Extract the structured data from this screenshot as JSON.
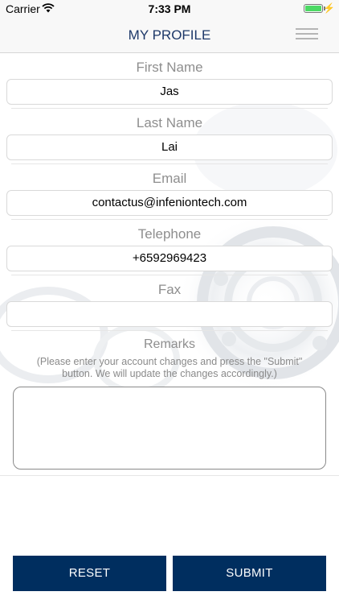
{
  "status_bar": {
    "carrier": "Carrier",
    "time": "7:33 PM",
    "battery_level": 1.0
  },
  "nav": {
    "title": "MY PROFILE",
    "menu_icon": "hamburger-menu-icon"
  },
  "form": {
    "first_name": {
      "label": "First Name",
      "value": "Jas"
    },
    "last_name": {
      "label": "Last Name",
      "value": "Lai"
    },
    "email": {
      "label": "Email",
      "value": "contactus@infeniontech.com"
    },
    "telephone": {
      "label": "Telephone",
      "value": "+6592969423"
    },
    "fax": {
      "label": "Fax",
      "value": ""
    },
    "remarks": {
      "label": "Remarks",
      "hint": "(Please enter your account changes and press the \"Submit\" button. We will update the changes accordingly.)",
      "value": ""
    }
  },
  "buttons": {
    "reset": "RESET",
    "submit": "SUBMIT"
  },
  "colors": {
    "accent": "#002e5f",
    "title": "#1d3869",
    "label": "#8e8e8e"
  }
}
